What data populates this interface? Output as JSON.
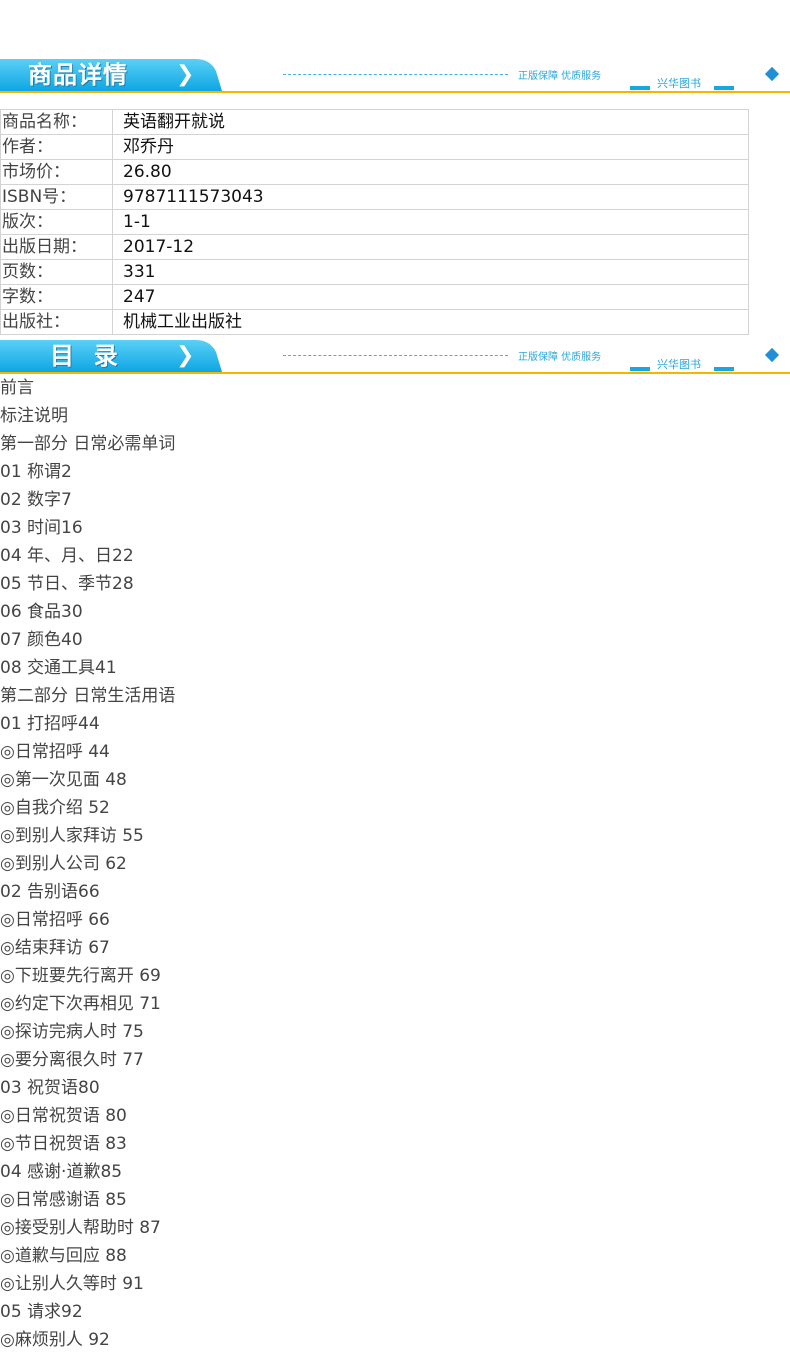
{
  "banners": {
    "details": {
      "title": "商品详情",
      "slogan": "正版保障 优质服务",
      "brand": "兴华图书"
    },
    "toc": {
      "title": "目  录",
      "slogan": "正版保障 优质服务",
      "brand": "兴华图书"
    }
  },
  "info_table": [
    {
      "label": "商品名称：",
      "value": "英语翻开就说"
    },
    {
      "label": "作者：",
      "value": "邓乔丹"
    },
    {
      "label": "市场价：",
      "value": "26.80"
    },
    {
      "label": "ISBN号：",
      "value": "9787111573043"
    },
    {
      "label": "版次：",
      "value": "1-1"
    },
    {
      "label": "出版日期：",
      "value": "2017-12"
    },
    {
      "label": "页数：",
      "value": "331"
    },
    {
      "label": "字数：",
      "value": "247"
    },
    {
      "label": "出版社：",
      "value": "机械工业出版社"
    }
  ],
  "toc_items": [
    "前言",
    "标注说明",
    "第一部分 日常必需单词",
    "01 称谓2",
    "02 数字7",
    "03 时间16",
    "04 年、月、日22",
    "05 节日、季节28",
    "06 食品30",
    "07 颜色40",
    "08 交通工具41",
    "第二部分 日常生活用语",
    "01 打招呼44",
    "◎日常招呼 44",
    "◎第一次见面 48",
    "◎自我介绍 52",
    "◎到别人家拜访 55",
    "◎到别人公司 62",
    "02 告别语66",
    "◎日常招呼 66",
    "◎结束拜访 67",
    "◎下班要先行离开 69",
    "◎约定下次再相见 71",
    "◎探访完病人时 75",
    "◎要分离很久时 77",
    "03 祝贺语80",
    "◎日常祝贺语 80",
    "◎节日祝贺语 83",
    "04 感谢·道歉85",
    "◎日常感谢语 85",
    "◎接受别人帮助时 87",
    "◎道歉与回应 88",
    "◎让别人久等时 91",
    "05 请求92",
    "◎麻烦别人 92"
  ],
  "colors": {
    "banner_cyan": "#1fb4ea",
    "banner_accent": "#f7b500",
    "text": "#333333"
  }
}
